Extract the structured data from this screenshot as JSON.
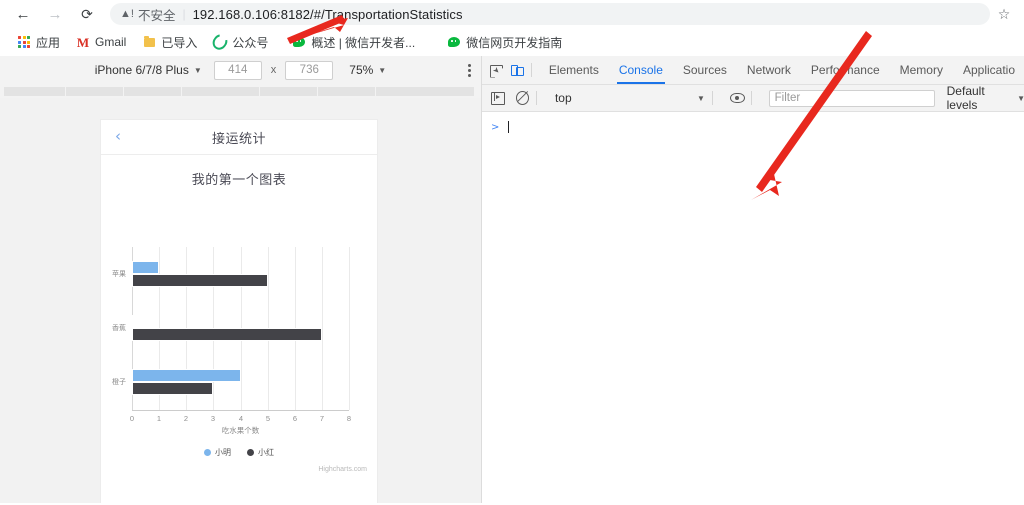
{
  "browser": {
    "back_icon": "back-arrow-icon",
    "forward_icon": "forward-arrow-icon",
    "reload_icon": "reload-icon",
    "security_icon": "warning-triangle-icon",
    "security_label": "不安全",
    "url": "192.168.0.106:8182/#/TransportationStatistics",
    "bookmark_star_icon": "star-icon"
  },
  "bookmarks": [
    {
      "label": "应用",
      "icon": "apps-grid-icon"
    },
    {
      "label": "Gmail",
      "icon": "gmail-icon"
    },
    {
      "label": "已导入",
      "icon": "folder-icon"
    },
    {
      "label": "公众号",
      "icon": "sync-ring-icon"
    },
    {
      "label": "概述 | 微信开发者...",
      "icon": "wechat-icon"
    },
    {
      "label": "微信网页开发指南",
      "icon": "wechat-icon"
    }
  ],
  "device_toolbar": {
    "device": "iPhone 6/7/8 Plus",
    "width": "414",
    "height": "736",
    "separator": "x",
    "zoom": "75%",
    "more_icon": "kebab-menu-icon"
  },
  "page": {
    "header_title": "接运统计",
    "back_icon": "chevron-left-icon"
  },
  "chart_data": {
    "type": "bar",
    "title": "我的第一个图表",
    "subtitle": "",
    "xlabel": "吃水果个数",
    "ylabel": "",
    "categories": [
      "苹果",
      "香蕉",
      "橙子"
    ],
    "series": [
      {
        "name": "小明",
        "color": "#7cb5ec",
        "values": [
          1,
          0,
          4
        ]
      },
      {
        "name": "小红",
        "color": "#434348",
        "values": [
          5,
          7,
          3
        ]
      }
    ],
    "ticks": [
      "0",
      "1",
      "2",
      "3",
      "4",
      "5",
      "6",
      "7",
      "8"
    ],
    "xlim": [
      0,
      8
    ],
    "grid": true,
    "legend_position": "bottom",
    "credit": "Highcharts.com"
  },
  "devtools": {
    "inspect_icon": "inspect-element-icon",
    "device_toggle_icon": "toggle-device-toolbar-icon",
    "tabs": [
      {
        "label": "Elements",
        "active": false
      },
      {
        "label": "Console",
        "active": true
      },
      {
        "label": "Sources",
        "active": false
      },
      {
        "label": "Network",
        "active": false
      },
      {
        "label": "Performance",
        "active": false
      },
      {
        "label": "Memory",
        "active": false
      },
      {
        "label": "Applicatio",
        "active": false
      }
    ],
    "console_toolbar": {
      "execution_context_icon": "execution-context-icon",
      "clear_icon": "clear-console-icon",
      "context": "top",
      "eye_icon": "live-expression-eye-icon",
      "filter_placeholder": "Filter",
      "filter_value": "",
      "levels": "Default levels"
    },
    "prompt": ">"
  },
  "annotations": {
    "arrow_color": "#e8281e"
  }
}
